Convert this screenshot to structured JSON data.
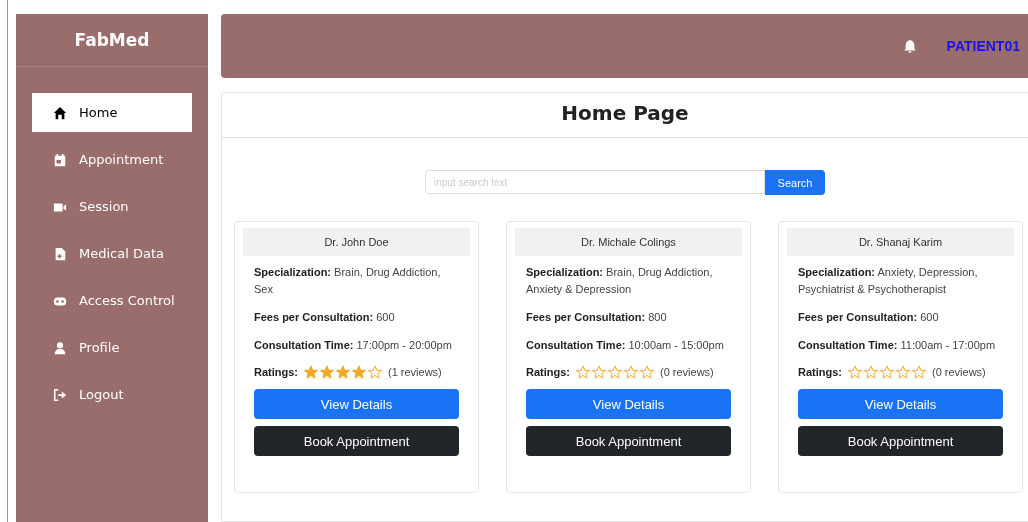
{
  "sidebar": {
    "brand": "FabMed",
    "items": [
      {
        "label": "Home",
        "selected": true
      },
      {
        "label": "Appointment",
        "selected": false
      },
      {
        "label": "Session",
        "selected": false
      },
      {
        "label": "Medical Data",
        "selected": false
      },
      {
        "label": "Access Control",
        "selected": false
      },
      {
        "label": "Profile",
        "selected": false
      },
      {
        "label": "Logout",
        "selected": false
      }
    ]
  },
  "header": {
    "user": "PATIENT01"
  },
  "page": {
    "title": "Home Page",
    "search": {
      "placeholder": "input search text",
      "button": "Search"
    }
  },
  "doctors": [
    {
      "name": "Dr. John Doe",
      "specialization_label": "Specialization:",
      "specialization": "Brain, Drug Addiction, Sex",
      "fees_label": "Fees per Consultation:",
      "fees": "600",
      "time_label": "Consultation Time:",
      "time": "17:00pm - 20:00pm",
      "ratings_label": "Ratings:",
      "stars": 4,
      "reviews": "(1 reviews)",
      "details_button": "View Details",
      "book_button": "Book Appointment"
    },
    {
      "name": "Dr. Michale Colings",
      "specialization_label": "Specialization:",
      "specialization": "Brain, Drug Addiction, Anxiety & Depression",
      "fees_label": "Fees per Consultation:",
      "fees": "800",
      "time_label": "Consultation Time:",
      "time": "10:00am - 15:00pm",
      "ratings_label": "Ratings:",
      "stars": 0,
      "reviews": "(0 reviews)",
      "details_button": "View Details",
      "book_button": "Book Appointment"
    },
    {
      "name": "Dr. Shanaj Karim",
      "specialization_label": "Specialization:",
      "specialization": "Anxiety, Depression, Psychiatrist & Psychotherapist",
      "fees_label": "Fees per Consultation:",
      "fees": "600",
      "time_label": "Consultation Time:",
      "time": "11:00am - 17:00pm",
      "ratings_label": "Ratings:",
      "stars": 0,
      "reviews": "(0 reviews)",
      "details_button": "View Details",
      "book_button": "Book Appointment"
    }
  ]
}
